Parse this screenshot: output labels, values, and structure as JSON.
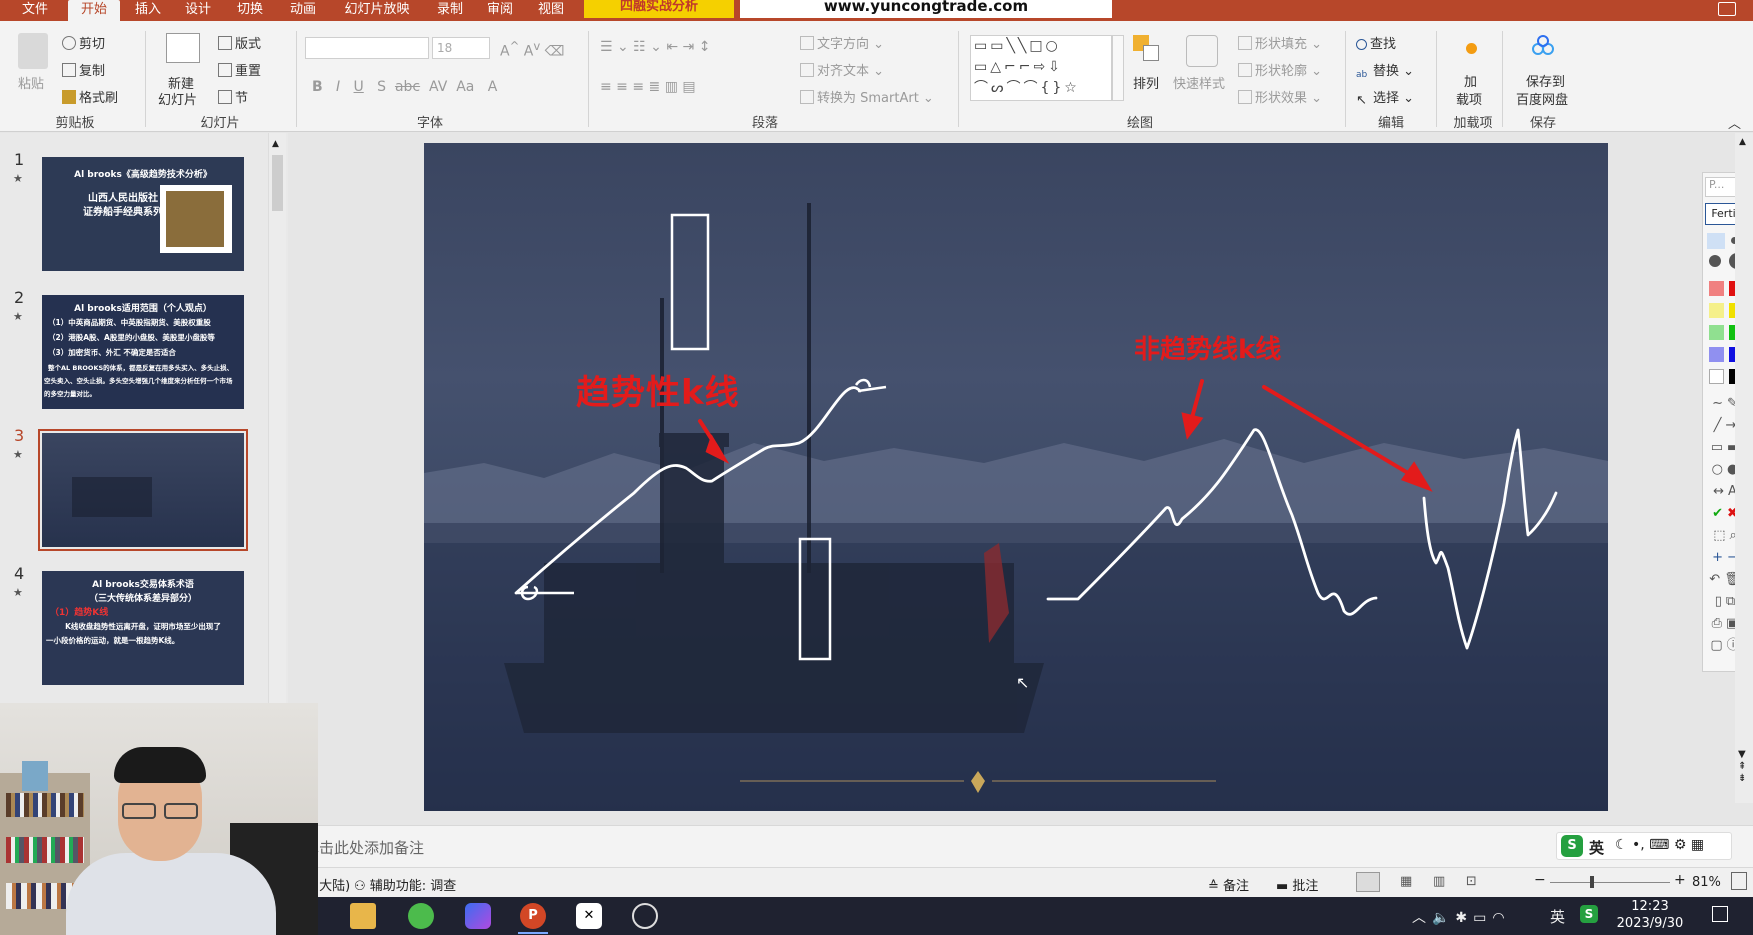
{
  "tabs": [
    "文件",
    "开始",
    "插入",
    "设计",
    "切换",
    "动画",
    "幻灯片放映",
    "录制",
    "审阅",
    "视图"
  ],
  "active_tab": "开始",
  "banners": {
    "left": "四融实战分析",
    "right": "www.yuncongtrade.com"
  },
  "ribbon": {
    "clipboard": {
      "paste": "粘贴",
      "cut": "剪切",
      "copy": "复制",
      "format_painter": "格式刷",
      "label": "剪贴板"
    },
    "slides": {
      "new_slide": "新建\n幻灯片",
      "new_slide_l1": "新建",
      "new_slide_l2": "幻灯片",
      "layout": "版式",
      "reset": "重置",
      "section": "节",
      "label": "幻灯片"
    },
    "font": {
      "label": "字体",
      "size": "18"
    },
    "paragraph": {
      "text_direction": "文字方向",
      "align_text": "对齐文本",
      "smartart": "转换为 SmartArt",
      "label": "段落"
    },
    "drawing": {
      "arrange": "排列",
      "quick_styles": "快速样式",
      "shape_fill": "形状填充",
      "shape_outline": "形状轮廓",
      "shape_effects": "形状效果",
      "label": "绘图"
    },
    "editing": {
      "find": "查找",
      "replace": "替换",
      "select": "选择",
      "label": "编辑"
    },
    "addins": {
      "addins_l1": "加",
      "addins_l2": "载项",
      "label": "加载项"
    },
    "save": {
      "save_l1": "保存到",
      "save_l2": "百度网盘",
      "label": "保存"
    }
  },
  "thumbnails": [
    {
      "num": "1",
      "lines": [
        "Al brooks《高级趋势技术分析》",
        "山西人民出版社",
        "证券船手经典系列"
      ]
    },
    {
      "num": "2",
      "lines": [
        "Al brooks适用范围（个人观点）",
        "（1）中英商品期货、中英股指期货、美股权重股",
        "（2）港股A股、A股里的小盘股、美股里小盘股等",
        "（3）加密货币、外汇 不确定是否适合",
        "整个AL BROOKS的体系，都是反复在用多头买入、多头止损、",
        "空头卖入、空头止损。多头空头增强几个维度来分析任何一个市场",
        "的多空力量对比。"
      ]
    },
    {
      "num": "3",
      "lines": []
    },
    {
      "num": "4",
      "lines": [
        "Al brooks交易体系术语",
        "（三大传统体系差异部分）",
        "（1）趋势K线",
        "K线收盘趋势性远离开盘，证明市场至少出现了",
        "一小段价格的运动，就是一根趋势K线。"
      ]
    }
  ],
  "slide": {
    "annotation_left": "趋势性k线",
    "annotation_right": "非趋势线k线"
  },
  "ink_panel": {
    "title": "P...",
    "done": "Fertig"
  },
  "notes_placeholder": "单击此处添加备注",
  "status": {
    "lang": "(中国大陆)",
    "accessibility": "辅助功能: 调查",
    "notes": "备注",
    "comments": "批注",
    "zoom": "81%"
  },
  "taskbar": {
    "time": "12:23",
    "date": "2023/9/30",
    "ime": "英",
    "ime_tray": "英"
  },
  "colors": {
    "accent": "#b7472a",
    "annotation": "#e31b1b"
  }
}
